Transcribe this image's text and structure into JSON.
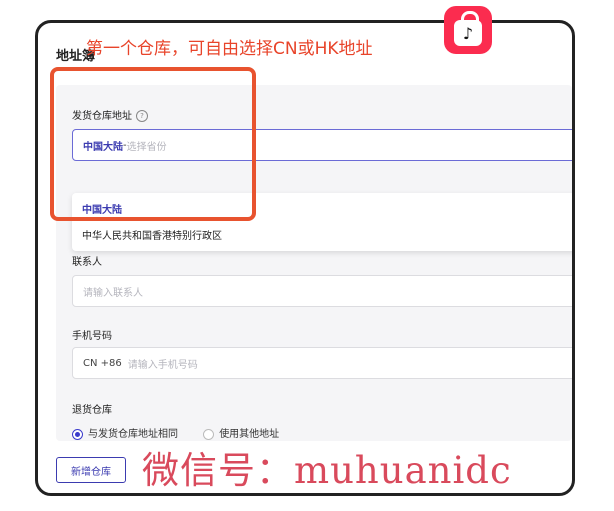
{
  "page": {
    "title": "地址簿",
    "annotation": "第一个仓库，可自由选择CN或HK地址",
    "tiktok_glyph": "♪"
  },
  "warehouse": {
    "label": "发货仓库地址",
    "help_glyph": "?",
    "selected_value": "中国大陆",
    "separator": " - ",
    "placeholder": "选择省份",
    "options": [
      "中国大陆",
      "中华人民共和国香港特别行政区"
    ]
  },
  "contact": {
    "label": "联系人",
    "placeholder": "请输入联系人"
  },
  "phone": {
    "label": "手机号码",
    "country_code": "CN +86",
    "placeholder": "请输入手机号码"
  },
  "return_warehouse": {
    "label": "退货仓库",
    "options": [
      "与发货仓库地址相同",
      "使用其他地址"
    ],
    "selected_index": 0
  },
  "actions": {
    "add_warehouse": "新增仓库"
  },
  "watermark": {
    "text": "微信号：muhuanidc"
  },
  "colors": {
    "accent": "#3b3bb0",
    "annotation": "#e8442a",
    "highlight_box": "#e8532f",
    "watermark": "#d94a5c",
    "tiktok": "#fb2c4f"
  }
}
